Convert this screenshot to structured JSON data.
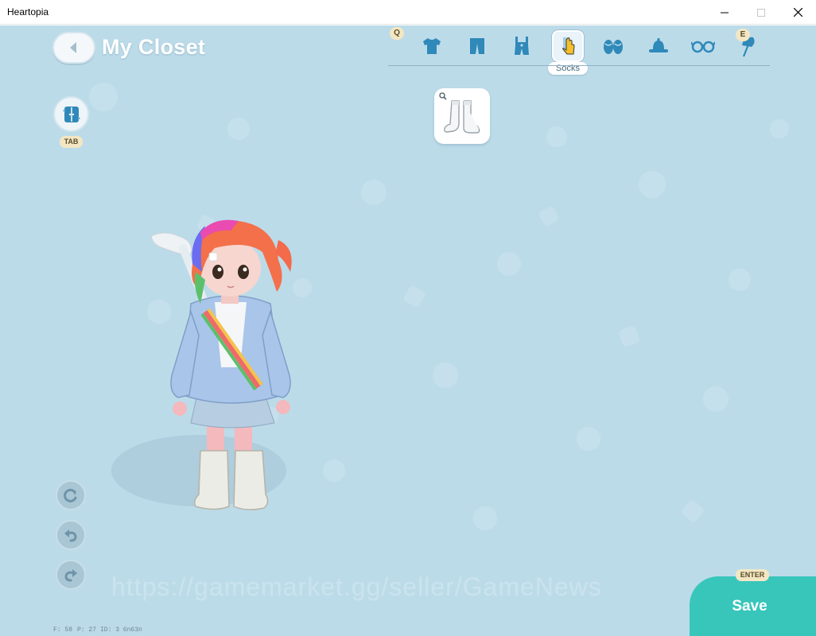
{
  "window": {
    "title": "Heartopia"
  },
  "header": {
    "title": "My Closet"
  },
  "categories": {
    "left_key": "Q",
    "right_key": "E",
    "active_label": "Socks",
    "items": [
      {
        "name": "shirt-icon"
      },
      {
        "name": "pants-icon"
      },
      {
        "name": "overalls-icon"
      },
      {
        "name": "socks-icon"
      },
      {
        "name": "sandals-icon"
      },
      {
        "name": "hat-icon"
      },
      {
        "name": "glasses-icon"
      },
      {
        "name": "umbrella-icon"
      }
    ]
  },
  "sidebar": {
    "tab_key": "TAB"
  },
  "item_slot": {
    "item": "white-socks-icon"
  },
  "watermark": "https://gamemarket.gg/seller/GameNews",
  "debug": {
    "f": "F: 58",
    "p": "P: 27",
    "id": "ID: 3 6n63n"
  },
  "save": {
    "key": "ENTER",
    "label": "Save"
  },
  "colors": {
    "background": "#bcdbe9",
    "save": "#38c6bb",
    "hint": "#f3e7c3"
  }
}
